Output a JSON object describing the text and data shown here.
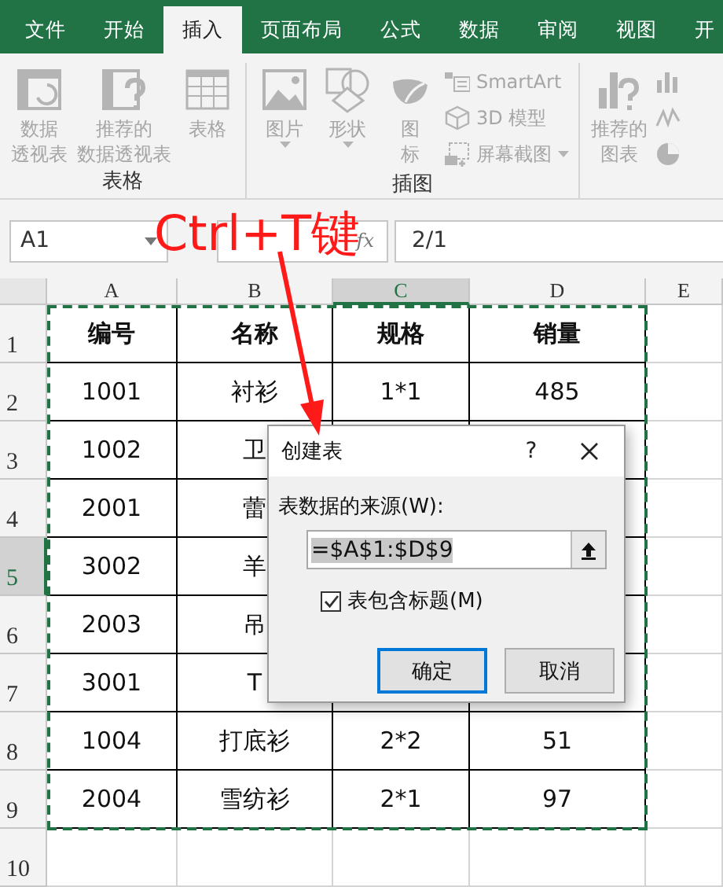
{
  "ribbon_tabs": [
    {
      "label": "文件",
      "selected": false
    },
    {
      "label": "开始",
      "selected": false
    },
    {
      "label": "插入",
      "selected": true
    },
    {
      "label": "页面布局",
      "selected": false
    },
    {
      "label": "公式",
      "selected": false
    },
    {
      "label": "数据",
      "selected": false
    },
    {
      "label": "审阅",
      "selected": false
    },
    {
      "label": "视图",
      "selected": false
    },
    {
      "label": "开",
      "selected": false
    }
  ],
  "ribbon": {
    "disabled": true,
    "groups": [
      {
        "label": "表格",
        "items": [
          {
            "kind": "large",
            "lines": [
              "数据",
              "透视表"
            ],
            "dropdown": false
          },
          {
            "kind": "large",
            "lines": [
              "推荐的",
              "数据透视表"
            ],
            "dropdown": false
          },
          {
            "kind": "large",
            "lines": [
              "表格"
            ],
            "dropdown": false
          }
        ]
      },
      {
        "label": "插图",
        "items": [
          {
            "kind": "large",
            "lines": [
              "图片"
            ],
            "dropdown": true
          },
          {
            "kind": "large",
            "lines": [
              "形状"
            ],
            "dropdown": true
          },
          {
            "kind": "large",
            "lines": [
              "图",
              "标"
            ],
            "dropdown": false
          },
          {
            "kind": "small",
            "label": "SmartArt",
            "dropdown": false
          },
          {
            "kind": "small",
            "label": "3D 模型",
            "dropdown": false
          },
          {
            "kind": "small",
            "label": "屏幕截图",
            "dropdown": true
          }
        ]
      },
      {
        "items": [
          {
            "kind": "large",
            "lines": [
              "推荐的",
              "图表"
            ],
            "dropdown": false
          },
          {
            "kind": "icon"
          },
          {
            "kind": "icon"
          },
          {
            "kind": "icon"
          }
        ]
      }
    ]
  },
  "formula_bar": {
    "name_box": "A1",
    "function_label": "fx",
    "formula": "2/1"
  },
  "annotation": {
    "text": "Ctrl+T键"
  },
  "sheet": {
    "columns": [
      {
        "label": "A",
        "selected": false
      },
      {
        "label": "B",
        "selected": false
      },
      {
        "label": "C",
        "selected": true
      },
      {
        "label": "D",
        "selected": false
      },
      {
        "label": "E",
        "selected": false
      }
    ],
    "rows": [
      {
        "header": "1",
        "selected": false,
        "kind": "header",
        "cells": [
          "编号",
          "名称",
          "规格",
          "销量"
        ]
      },
      {
        "header": "2",
        "selected": false,
        "kind": "data",
        "cells": [
          "1001",
          "衬衫",
          "1*1",
          "485"
        ]
      },
      {
        "header": "3",
        "selected": false,
        "kind": "data",
        "cells": [
          "1002",
          "卫"
        ]
      },
      {
        "header": "4",
        "selected": false,
        "kind": "data",
        "cells": [
          "2001",
          "蕾"
        ]
      },
      {
        "header": "5",
        "selected": true,
        "kind": "data",
        "cells": [
          "3002",
          "羊"
        ]
      },
      {
        "header": "6",
        "selected": false,
        "kind": "data",
        "cells": [
          "2003",
          "吊"
        ]
      },
      {
        "header": "7",
        "selected": false,
        "kind": "data",
        "cells": [
          "3001",
          "T"
        ]
      },
      {
        "header": "8",
        "selected": false,
        "kind": "data",
        "cells": [
          "1004",
          "打底衫",
          "2*2",
          "51"
        ]
      },
      {
        "header": "9",
        "selected": false,
        "kind": "data",
        "cells": [
          "2004",
          "雪纺衫",
          "2*1",
          "97"
        ]
      },
      {
        "header": "10",
        "selected": false,
        "kind": "empty"
      }
    ]
  },
  "dialog": {
    "title": "创建表",
    "help": "?",
    "source_label": "表数据的来源(W):",
    "source_value": "=$A$1:$D$9",
    "checkbox": {
      "label": "表包含标题(M)",
      "checked": true
    },
    "buttons": [
      {
        "label": "确定",
        "default": true
      },
      {
        "label": "取消",
        "default": false
      }
    ]
  }
}
